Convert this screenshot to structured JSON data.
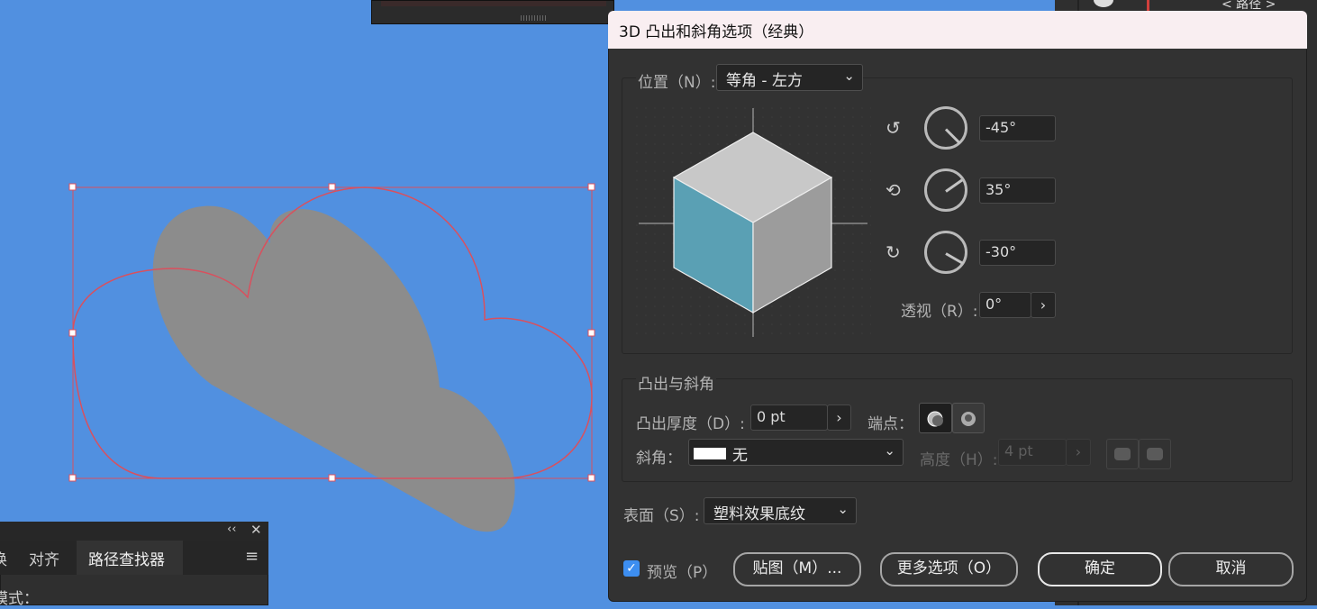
{
  "dialog": {
    "title": "3D 凸出和斜角选项（经典）",
    "position_label": "位置（N）:",
    "position_value": "等角 - 左方",
    "rotation_x": "-45°",
    "rotation_y": "35°",
    "rotation_z": "-30°",
    "perspective_label": "透视（R）:",
    "perspective_value": "0°",
    "extrude_section": "凸出与斜角",
    "extrude_depth_label": "凸出厚度（D）:",
    "extrude_depth_value": "0 pt",
    "cap_label": "端点：",
    "bevel_label": "斜角：",
    "bevel_value": "无",
    "height_label": "高度（H）:",
    "height_value": "4 pt",
    "surface_label": "表面（S）:",
    "surface_value": "塑料效果底纹",
    "preview_label": "预览（P）",
    "preview_checked": true,
    "map_button": "贴图（M）...",
    "more_options_button": "更多选项（O）",
    "ok_button": "确定",
    "cancel_button": "取消"
  },
  "bottom_panel": {
    "tabs": [
      "换",
      "对齐",
      "路径查找器"
    ],
    "active_tab": "路径查找器",
    "mode_label": "模式："
  },
  "right_strip": {
    "path_label": "< 路径 >"
  },
  "colors": {
    "canvas": "#5190e0",
    "cube_left": "#5aa0b4",
    "cube_top": "#c8c8c8",
    "cube_right": "#9c9c9c",
    "accent": "#3d8ef0"
  },
  "icons": [
    "rotate-x-icon",
    "rotate-y-icon",
    "rotate-z-icon",
    "cap-on-icon",
    "cap-off-icon",
    "bevel-out-icon",
    "bevel-in-icon",
    "menu-icon",
    "close-icon",
    "collapse-icon"
  ]
}
